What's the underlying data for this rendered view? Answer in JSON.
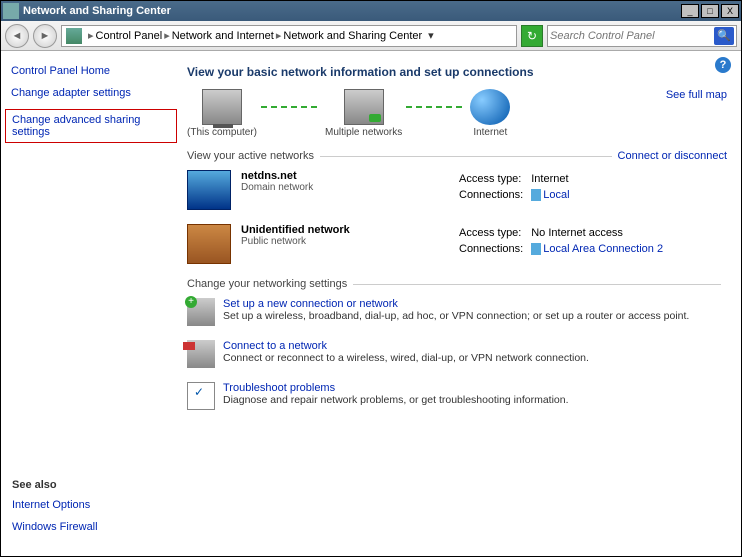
{
  "window": {
    "title": "Network and Sharing Center"
  },
  "titlebar_buttons": {
    "min": "_",
    "max": "□",
    "close": "X"
  },
  "breadcrumb": {
    "items": [
      "Control Panel",
      "Network and Internet",
      "Network and Sharing Center"
    ]
  },
  "search": {
    "placeholder": "Search Control Panel"
  },
  "sidebar": {
    "home": "Control Panel Home",
    "adapter": "Change adapter settings",
    "sharing": "Change advanced sharing settings"
  },
  "seealso": {
    "heading": "See also",
    "links": [
      "Internet Options",
      "Windows Firewall"
    ]
  },
  "main": {
    "heading": "View your basic network information and set up connections",
    "full_map": "See full map",
    "map": {
      "this_pc": "(This computer)",
      "multi": "Multiple networks",
      "internet": "Internet"
    },
    "active_heading": "View your active networks",
    "connect_link": "Connect or disconnect",
    "networks": [
      {
        "name": "netdns.net",
        "type": "Domain network",
        "access_label": "Access type:",
        "access_value": "Internet",
        "conn_label": "Connections:",
        "conn_value": "Local"
      },
      {
        "name": "Unidentified network",
        "type": "Public network",
        "access_label": "Access type:",
        "access_value": "No Internet access",
        "conn_label": "Connections:",
        "conn_value": "Local Area Connection 2"
      }
    ],
    "change_heading": "Change your networking settings",
    "tasks": [
      {
        "title": "Set up a new connection or network",
        "desc": "Set up a wireless, broadband, dial-up, ad hoc, or VPN connection; or set up a router or access point."
      },
      {
        "title": "Connect to a network",
        "desc": "Connect or reconnect to a wireless, wired, dial-up, or VPN network connection."
      },
      {
        "title": "Troubleshoot problems",
        "desc": "Diagnose and repair network problems, or get troubleshooting information."
      }
    ]
  }
}
